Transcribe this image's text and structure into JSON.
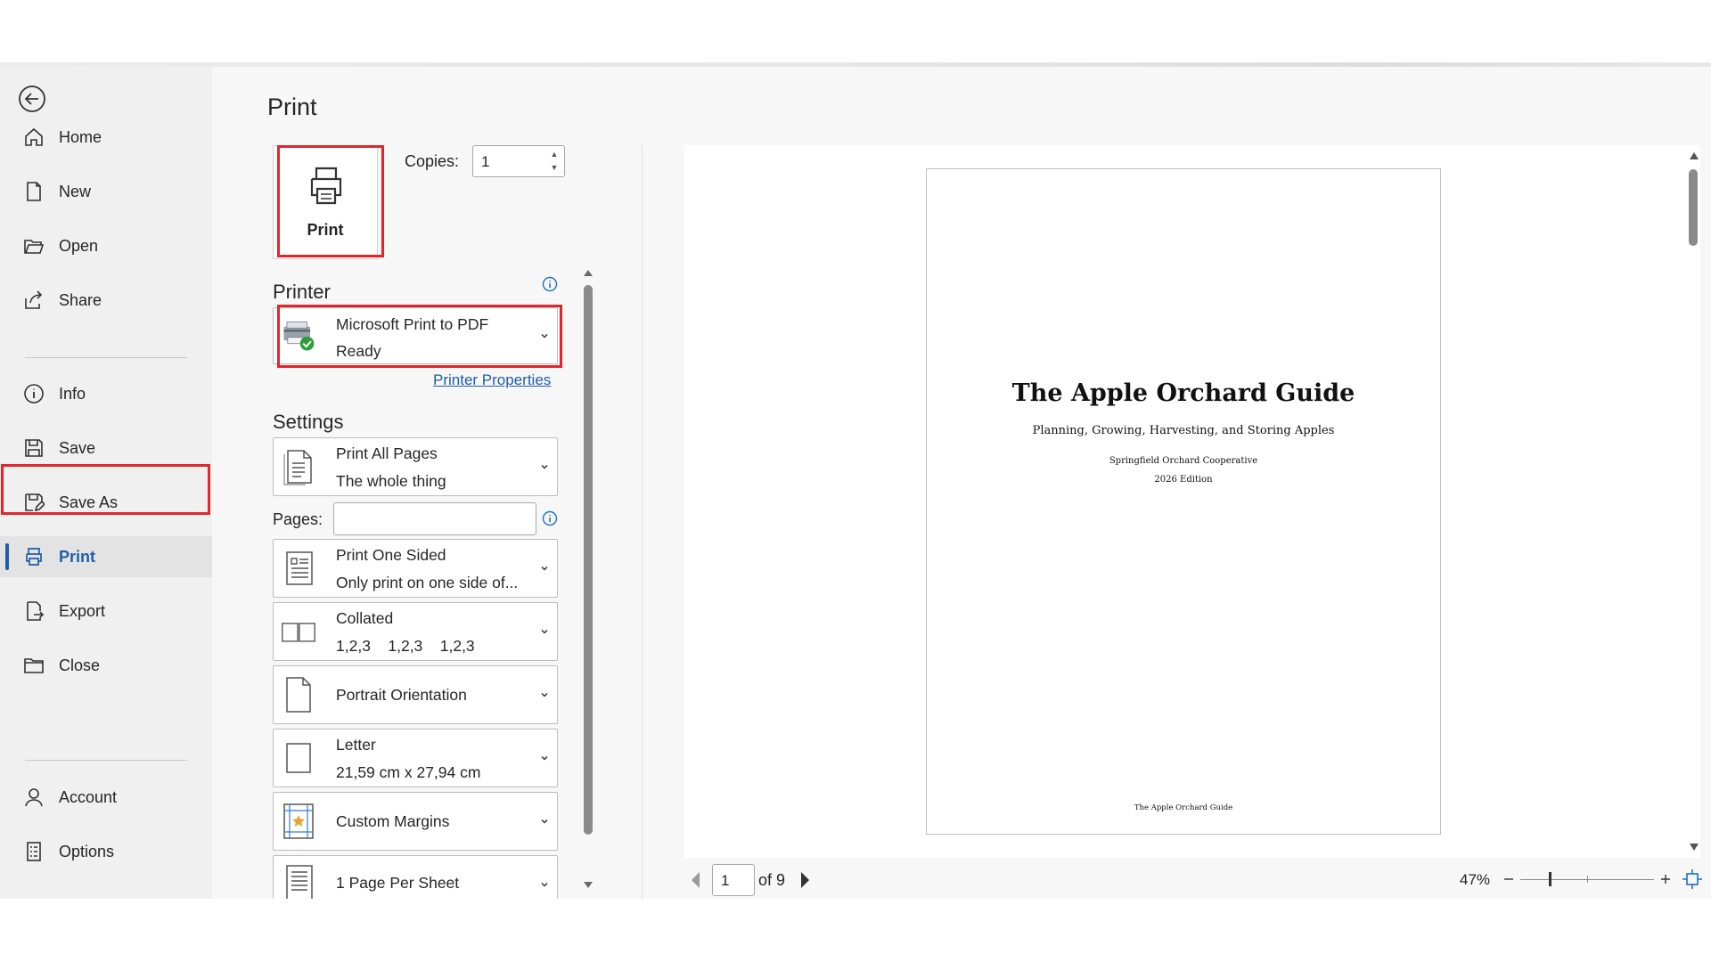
{
  "sidebar": {
    "items": [
      {
        "label": "Home",
        "icon": "home-icon"
      },
      {
        "label": "New",
        "icon": "new-document-icon"
      },
      {
        "label": "Open",
        "icon": "folder-open-icon"
      },
      {
        "label": "Share",
        "icon": "share-icon"
      },
      {
        "label": "Info",
        "icon": "info-icon"
      },
      {
        "label": "Save",
        "icon": "save-icon"
      },
      {
        "label": "Save As",
        "icon": "save-as-icon"
      },
      {
        "label": "Print",
        "icon": "printer-icon",
        "active": true
      },
      {
        "label": "Export",
        "icon": "export-icon"
      },
      {
        "label": "Close",
        "icon": "folder-close-icon"
      },
      {
        "label": "Account",
        "icon": "person-icon"
      },
      {
        "label": "Options",
        "icon": "options-icon"
      }
    ]
  },
  "print": {
    "title": "Print",
    "button_label": "Print",
    "copies_label": "Copies:",
    "copies_value": "1"
  },
  "printer": {
    "section_label": "Printer",
    "name": "Microsoft Print to PDF",
    "status": "Ready",
    "properties_link": "Printer Properties"
  },
  "settings": {
    "section_label": "Settings",
    "pages_label": "Pages:",
    "pages_value": "",
    "range": {
      "title": "Print All Pages",
      "subtitle": "The whole thing"
    },
    "sides": {
      "title": "Print One Sided",
      "subtitle": "Only print on one side of..."
    },
    "collation": {
      "title": "Collated",
      "subtitle": "1,2,3    1,2,3    1,2,3"
    },
    "orientation": {
      "title": "Portrait Orientation"
    },
    "paper": {
      "title": "Letter",
      "subtitle": "21,59 cm x 27,94 cm"
    },
    "margins": {
      "title": "Custom Margins"
    },
    "per_sheet": {
      "title": "1 Page Per Sheet"
    }
  },
  "preview": {
    "doc_title": "The Apple Orchard Guide",
    "doc_subtitle": "Planning, Growing, Harvesting, and Storing Apples",
    "doc_org": "Springfield Orchard Cooperative",
    "doc_edition": "2026 Edition",
    "doc_footer": "The Apple Orchard Guide",
    "current_page": "1",
    "total_pages": "of 9",
    "zoom": "47%"
  },
  "colors": {
    "accent": "#1f5ea8",
    "highlight": "#e0262c",
    "success": "#2e9e3b"
  }
}
